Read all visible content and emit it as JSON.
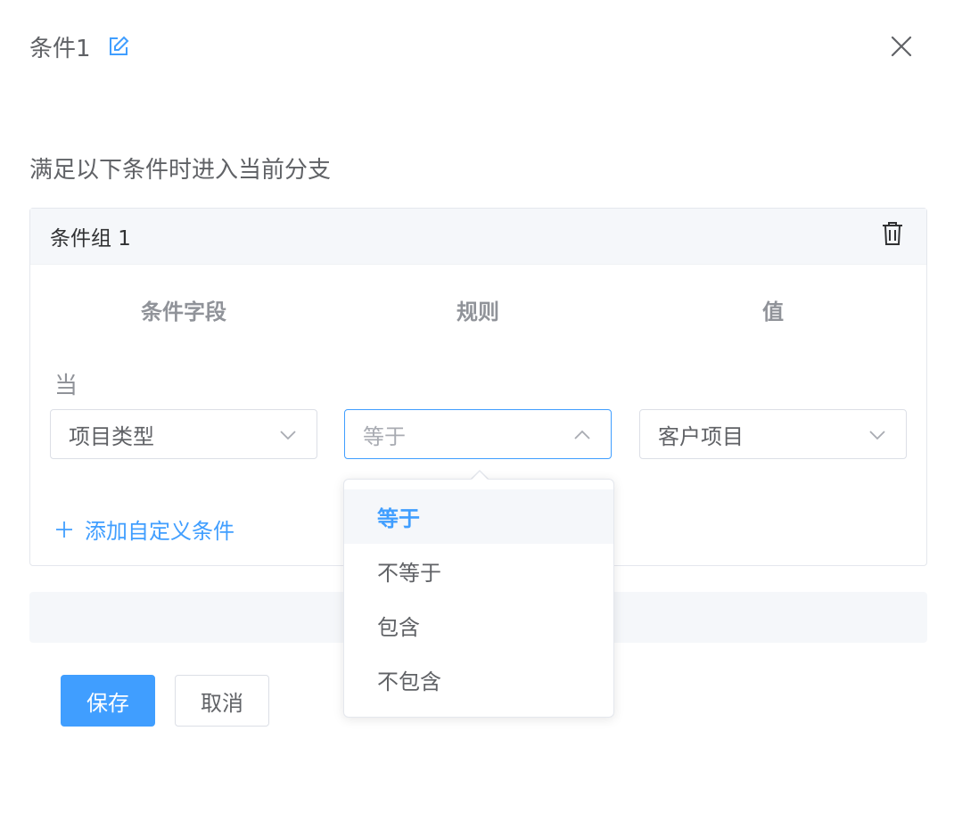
{
  "header": {
    "title": "条件1"
  },
  "subtitle": "满足以下条件时进入当前分支",
  "group": {
    "title": "条件组 1",
    "columns": {
      "field": "条件字段",
      "rule": "规则",
      "value": "值"
    },
    "when_label": "当",
    "field_select": {
      "value": "项目类型"
    },
    "rule_select": {
      "placeholder": "等于"
    },
    "value_select": {
      "value": "客户项目"
    },
    "add_condition_label": "添加自定义条件"
  },
  "dropdown": {
    "options": [
      {
        "label": "等于",
        "selected": true
      },
      {
        "label": "不等于",
        "selected": false
      },
      {
        "label": "包含",
        "selected": false
      },
      {
        "label": "不包含",
        "selected": false
      }
    ]
  },
  "footer": {
    "save_label": "保存",
    "cancel_label": "取消"
  },
  "colors": {
    "primary": "#409eff",
    "text": "#606266",
    "muted": "#909399",
    "border": "#dcdfe6"
  }
}
